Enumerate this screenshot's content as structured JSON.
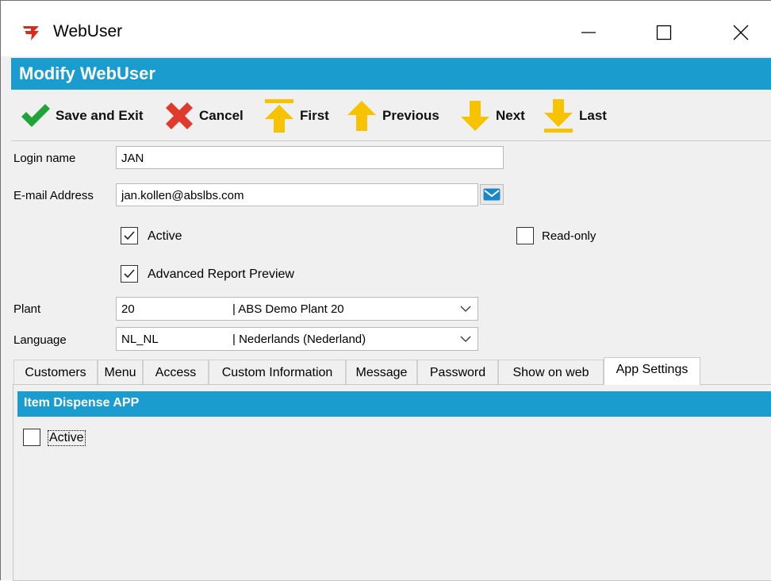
{
  "window": {
    "title": "WebUser",
    "icon": "red-arrow-app-icon",
    "controls": {
      "minimize": "minimize-icon",
      "maximize": "maximize-icon",
      "close": "close-icon"
    }
  },
  "header": {
    "title": "Modify WebUser",
    "color": "#1a9ccf"
  },
  "toolbar": {
    "save_label": "Save and Exit",
    "cancel_label": "Cancel",
    "first_label": "First",
    "previous_label": "Previous",
    "next_label": "Next",
    "last_label": "Last"
  },
  "form": {
    "login_label": "Login name",
    "login_value": "JAN",
    "email_label": "E-mail Address",
    "email_value": "jan.kollen@abslbs.com",
    "active_label": "Active",
    "active_checked": true,
    "readonly_label": "Read-only",
    "readonly_checked": false,
    "advanced_label": "Advanced Report Preview",
    "advanced_checked": true,
    "plant_label": "Plant",
    "plant_code": "20",
    "plant_desc": "| ABS Demo Plant 20",
    "language_label": "Language",
    "language_code": "NL_NL",
    "language_desc": "| Nederlands (Nederland)"
  },
  "tabs": [
    {
      "label": "Customers"
    },
    {
      "label": "Menu"
    },
    {
      "label": "Access"
    },
    {
      "label": "Custom Information"
    },
    {
      "label": "Message"
    },
    {
      "label": "Password"
    },
    {
      "label": "Show on web"
    },
    {
      "label": "App Settings",
      "active": true
    }
  ],
  "app_settings": {
    "group_title": "Item Dispense APP",
    "active_label": "Active",
    "active_checked": false
  },
  "colors": {
    "accent": "#1a9ccf",
    "save_green": "#22a33a",
    "cancel_red": "#e03a2c",
    "nav_yellow": "#f7c200"
  }
}
